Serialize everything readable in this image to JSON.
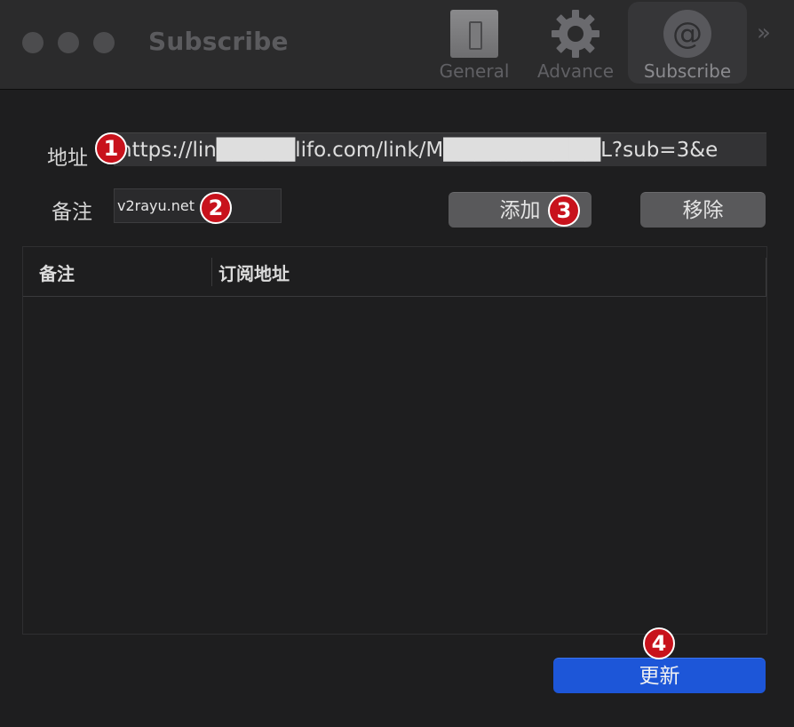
{
  "window": {
    "title": "Subscribe"
  },
  "toolbar": {
    "items": [
      {
        "label": "General",
        "icon": "switch-icon",
        "selected": false
      },
      {
        "label": "Advance",
        "icon": "gear-icon",
        "selected": false
      },
      {
        "label": "Subscribe",
        "icon": "at-sign-icon",
        "selected": true
      }
    ],
    "overflow_glyph": "»"
  },
  "form": {
    "address_label": "地址",
    "address_value": "https://lin█████lifo.com/link/M██████████L?sub=3&e",
    "note_label": "备注",
    "note_value": "v2rayu.net",
    "add_button": "添加",
    "remove_button": "移除"
  },
  "table": {
    "columns": [
      "备注",
      "订阅地址"
    ],
    "rows": []
  },
  "update_button": "更新",
  "annotations": [
    "1",
    "2",
    "3",
    "4"
  ],
  "colors": {
    "accent": "#1d56d8",
    "badge": "#c8121c",
    "background": "#1e1e1f"
  }
}
